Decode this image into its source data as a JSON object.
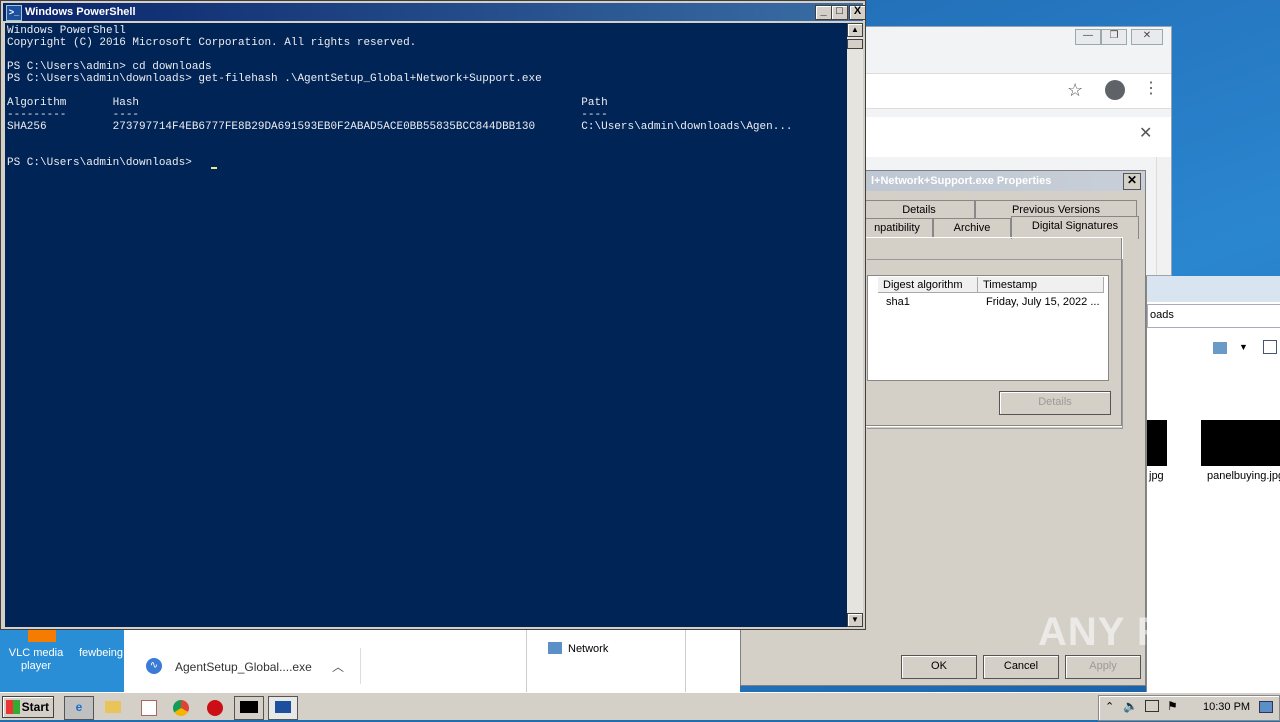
{
  "powershell": {
    "title": "Windows PowerShell",
    "lines": [
      "Windows PowerShell",
      "Copyright (C) 2016 Microsoft Corporation. All rights reserved.",
      "",
      "PS C:\\Users\\admin> cd downloads",
      "PS C:\\Users\\admin\\downloads> get-filehash .\\AgentSetup_Global+Network+Support.exe",
      "",
      "Algorithm       Hash                                                                   Path",
      "---------       ----                                                                   ----",
      "SHA256          273797714F4EB6777FE8B29DA691593EB0F2ABAD5ACE0BB55835BCC844DBB130       C:\\Users\\admin\\downloads\\Agen...",
      "",
      "",
      "PS C:\\Users\\admin\\downloads> "
    ],
    "minimize": "_",
    "maximize": "□",
    "close": "X"
  },
  "properties": {
    "title": "l+Network+Support.exe Properties",
    "tabs_row1": [
      "Details",
      "Previous Versions"
    ],
    "tabs_row2": [
      "npatibility",
      "Archive",
      "Digital Signatures"
    ],
    "table_headers": [
      "Digest algorithm",
      "Timestamp"
    ],
    "row": {
      "digest": "sha1",
      "timestamp": "Friday, July 15, 2022 ..."
    },
    "details_button": "Details",
    "ok": "OK",
    "cancel": "Cancel",
    "apply": "Apply"
  },
  "explorer": {
    "path": "oads",
    "files": [
      "jpg",
      "panelbuying.jpg"
    ]
  },
  "downloads": {
    "file": "AgentSetup_Global....exe",
    "network": "Network"
  },
  "desktop": {
    "icon1": "VLC media player",
    "icon2": "fewbeing"
  },
  "taskbar": {
    "start": "Start",
    "clock": "10:30 PM"
  },
  "watermark": "ANY RUN"
}
